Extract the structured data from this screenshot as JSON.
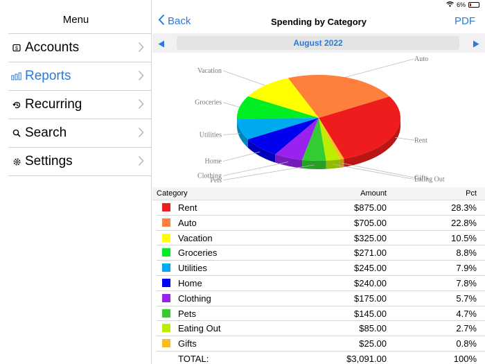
{
  "status": {
    "battery_text": "6%"
  },
  "sidebar": {
    "title": "Menu",
    "items": [
      {
        "label": "Accounts",
        "icon": "dollar-icon"
      },
      {
        "label": "Reports",
        "icon": "bar-chart-icon",
        "active": true
      },
      {
        "label": "Recurring",
        "icon": "repeat-icon"
      },
      {
        "label": "Search",
        "icon": "search-icon"
      },
      {
        "label": "Settings",
        "icon": "gear-icon"
      }
    ]
  },
  "nav": {
    "back": "Back",
    "title": "Spending by Category",
    "pdf": "PDF"
  },
  "month": "August 2022",
  "table": {
    "headers": {
      "category": "Category",
      "amount": "Amount",
      "pct": "Pct"
    },
    "rows": [
      {
        "category": "Rent",
        "amount": "$875.00",
        "pct": "28.3%",
        "color": "#ee1c1c"
      },
      {
        "category": "Auto",
        "amount": "$705.00",
        "pct": "22.8%",
        "color": "#ff7f3c"
      },
      {
        "category": "Vacation",
        "amount": "$325.00",
        "pct": "10.5%",
        "color": "#ffff00"
      },
      {
        "category": "Groceries",
        "amount": "$271.00",
        "pct": "8.8%",
        "color": "#00ee22"
      },
      {
        "category": "Utilities",
        "amount": "$245.00",
        "pct": "7.9%",
        "color": "#00aaee"
      },
      {
        "category": "Home",
        "amount": "$240.00",
        "pct": "7.8%",
        "color": "#0000ee"
      },
      {
        "category": "Clothing",
        "amount": "$175.00",
        "pct": "5.7%",
        "color": "#9922ee"
      },
      {
        "category": "Pets",
        "amount": "$145.00",
        "pct": "4.7%",
        "color": "#33cc33"
      },
      {
        "category": "Eating Out",
        "amount": "$85.00",
        "pct": "2.7%",
        "color": "#bbee00"
      },
      {
        "category": "Gifts",
        "amount": "$25.00",
        "pct": "0.8%",
        "color": "#ffbb22"
      }
    ],
    "total": {
      "label": "TOTAL:",
      "amount": "$3,091.00",
      "pct": "100%"
    }
  },
  "chart_data": {
    "type": "pie",
    "categories": [
      "Rent",
      "Auto",
      "Vacation",
      "Groceries",
      "Utilities",
      "Home",
      "Clothing",
      "Pets",
      "Eating Out",
      "Gifts"
    ],
    "values": [
      875,
      705,
      325,
      271,
      245,
      240,
      175,
      145,
      85,
      25
    ],
    "colors": [
      "#ee1c1c",
      "#ff7f3c",
      "#ffff00",
      "#00ee22",
      "#00aaee",
      "#0000ee",
      "#9922ee",
      "#33cc33",
      "#bbee00",
      "#ffbb22"
    ],
    "style": "3d",
    "title": ""
  }
}
